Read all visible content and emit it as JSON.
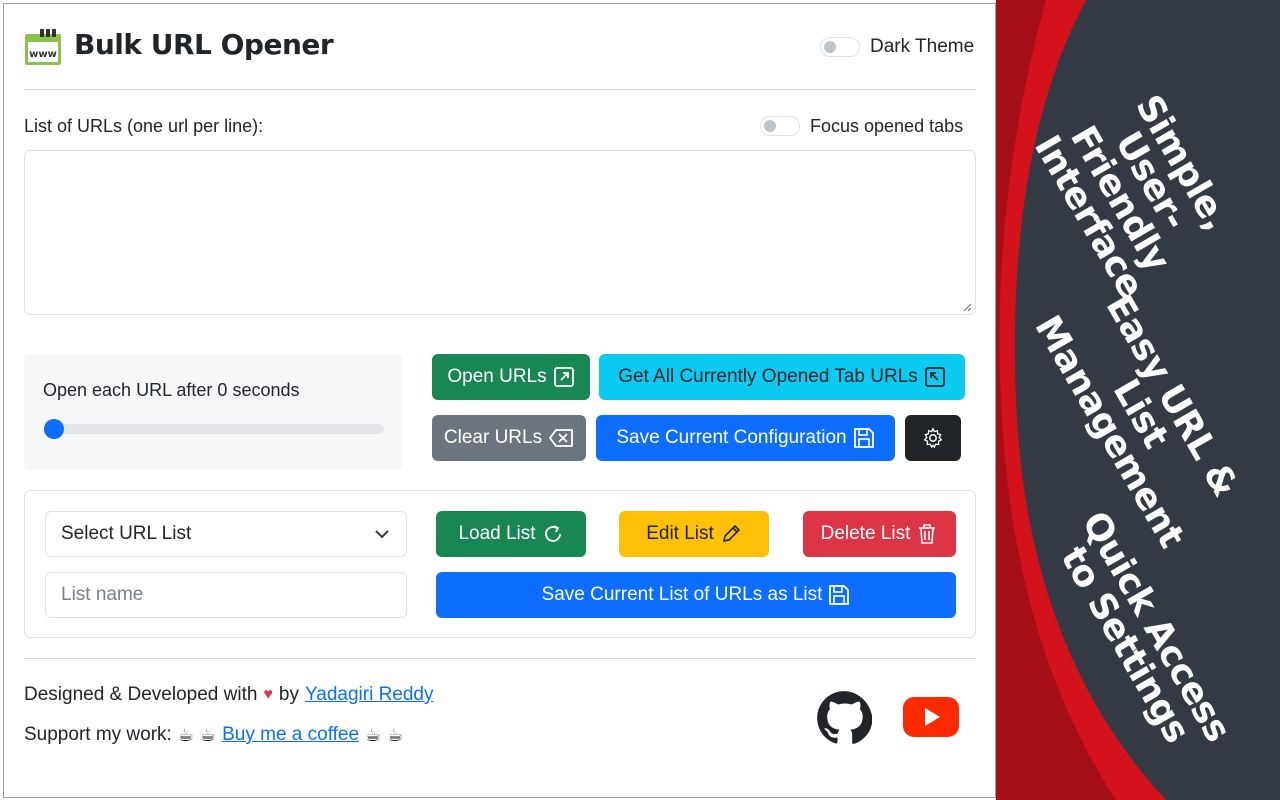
{
  "app": {
    "title": "Bulk URL Opener"
  },
  "header": {
    "dark_theme_label": "Dark Theme"
  },
  "urls": {
    "label": "List of URLs (one url per line):",
    "focus_label": "Focus opened tabs",
    "value": ""
  },
  "delay": {
    "label": "Open each URL after 0 seconds",
    "value_seconds": 0
  },
  "buttons": {
    "open_urls": "Open URLs",
    "get_tabs": "Get All Currently Opened Tab URLs",
    "clear_urls": "Clear URLs",
    "save_config": "Save Current Configuration",
    "load_list": "Load List",
    "edit_list": "Edit List",
    "delete_list": "Delete List",
    "save_as_list": "Save Current List of URLs as List"
  },
  "lists": {
    "select_value": "Select URL List",
    "name_placeholder": "List name"
  },
  "footer": {
    "designed_prefix": "Designed & Developed with",
    "designed_by": "by",
    "author": "Yadagiri Reddy",
    "support_prefix": "Support my work:",
    "coffee_link": "Buy me a coffee"
  },
  "promo": {
    "line1": "Simple,\nUser-Friendly\nInterface",
    "line2": "Easy URL & List\nManagement",
    "line3": "Quick Access\nto Settings"
  },
  "colors": {
    "primary": "#0d6efd",
    "success": "#198754",
    "info": "#0dcaf0",
    "secondary": "#6c757d",
    "warning": "#ffc107",
    "danger": "#dc3545",
    "promo_bg": "#343a44",
    "promo_accent": "#d3121b"
  },
  "icons": [
    "www-logo-icon",
    "box-arrow-up-right-icon",
    "box-arrow-up-left-icon",
    "backspace-icon",
    "floppy-icon",
    "gear-icon",
    "chevron-down-icon",
    "refresh-icon",
    "pencil-icon",
    "trash-icon",
    "heart-icon",
    "coffee-icon",
    "github-icon",
    "youtube-icon"
  ]
}
